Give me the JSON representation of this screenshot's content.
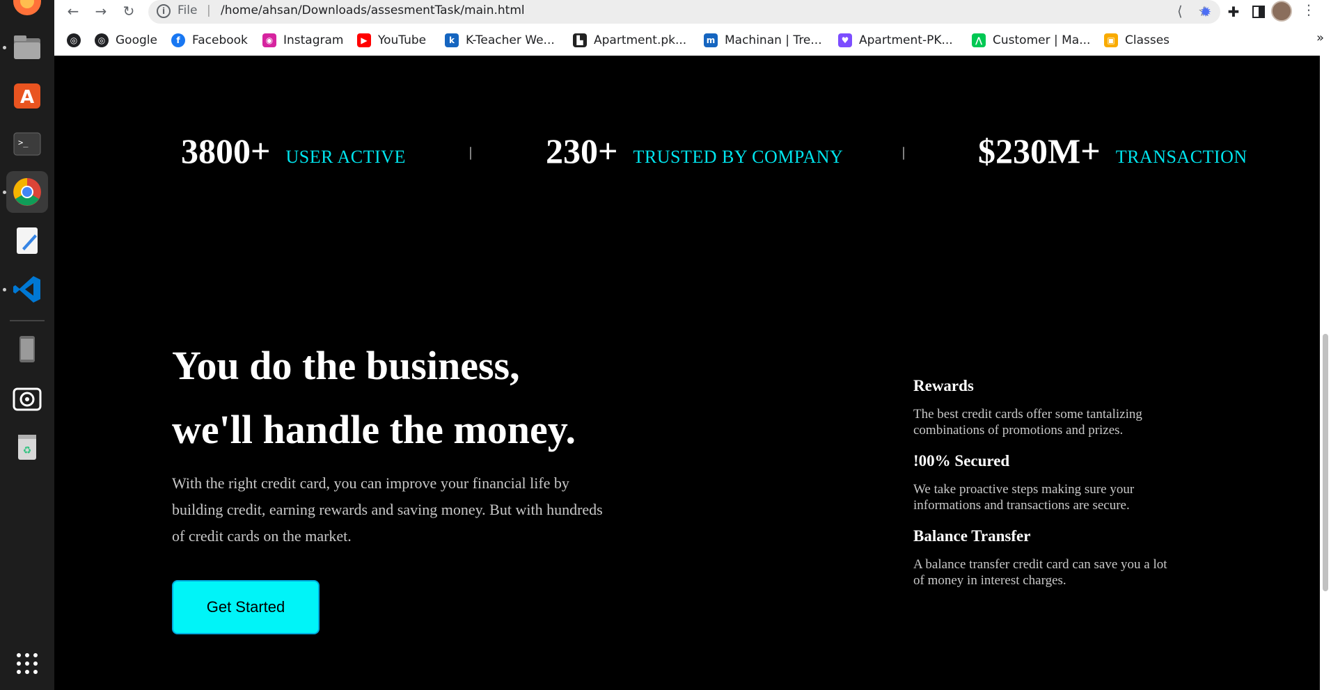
{
  "browser": {
    "omnibox": {
      "scheme": "File",
      "separator": "|",
      "url": "/home/ahsan/Downloads/assesmentTask/main.html"
    },
    "bookmarks": [
      {
        "label": "",
        "icon": "globe-icon"
      },
      {
        "label": "Google",
        "icon": "globe-icon"
      },
      {
        "label": "Facebook",
        "icon": "facebook-icon",
        "color": "#1877f2"
      },
      {
        "label": "Instagram",
        "icon": "instagram-icon",
        "color": "#d6249f"
      },
      {
        "label": "YouTube",
        "icon": "youtube-icon",
        "color": "#ff0000"
      },
      {
        "label": "K-Teacher We...",
        "icon": "k-teacher-icon",
        "color": "#1565c0"
      },
      {
        "label": "Apartment.pk...",
        "icon": "apartment-pk-icon",
        "color": "#222222"
      },
      {
        "label": "Machinan | Tre...",
        "icon": "machinan-icon",
        "color": "#1565c0"
      },
      {
        "label": "Apartment-PK...",
        "icon": "apartment-pk-heart-icon",
        "color": "#7c4dff"
      },
      {
        "label": "Customer | Ma...",
        "icon": "customer-icon",
        "color": "#00c853"
      },
      {
        "label": "Classes",
        "icon": "classes-icon",
        "color": "#f9ab00"
      }
    ],
    "more_bookmarks": "»"
  },
  "stats": [
    {
      "number": "3800+",
      "label": "USER ACTIVE"
    },
    {
      "number": "230+",
      "label": "TRUSTED BY COMPANY"
    },
    {
      "number": "$230M+",
      "label": "TRANSACTION"
    }
  ],
  "divider": "|",
  "hero": {
    "headline_line1": "You do the business,",
    "headline_line2": "we'll handle the money.",
    "intro": "With the right credit card, you can improve your financial life by building credit, earning rewards and saving money. But with hundreds of credit cards on the market.",
    "cta_label": "Get Started"
  },
  "features": [
    {
      "title": "Rewards",
      "desc": "The best credit cards offer some tantalizing combinations of promotions and prizes."
    },
    {
      "title": "!00% Secured",
      "desc": "We take proactive steps making sure your informations and transactions are secure."
    },
    {
      "title": "Balance Transfer",
      "desc": "A balance transfer credit card can save you a lot of money in interest charges."
    }
  ],
  "colors": {
    "accent": "#00f4f8",
    "stat_label": "#00e5ee",
    "page_bg": "#000000"
  }
}
